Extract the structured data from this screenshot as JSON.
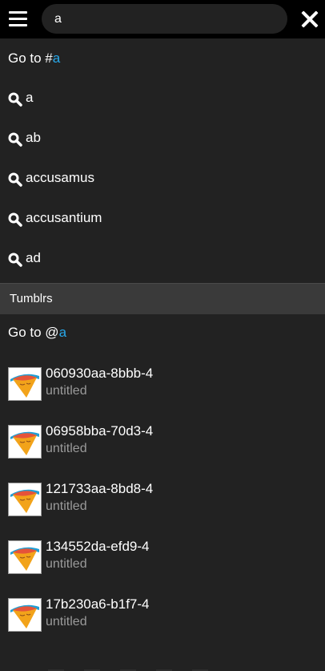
{
  "search": {
    "value": "a",
    "menu_icon": "hamburger-menu-icon",
    "close_icon": "close-x-icon"
  },
  "tag_goto": {
    "prefix": "Go to #",
    "term": "a"
  },
  "suggestions": [
    {
      "icon": "search-icon",
      "text": "a"
    },
    {
      "icon": "search-icon",
      "text": "ab"
    },
    {
      "icon": "search-icon",
      "text": "accusamus"
    },
    {
      "icon": "search-icon",
      "text": "accusantium"
    },
    {
      "icon": "search-icon",
      "text": "ad"
    }
  ],
  "tumblrs_section": {
    "heading": "Tumblrs"
  },
  "blog_goto": {
    "prefix": "Go to @",
    "term": "a"
  },
  "blogs": [
    {
      "name": "060930aa-8bbb-4",
      "title": "untitled",
      "avatar": "ice-cream-cone-avatar"
    },
    {
      "name": "06958bba-70d3-4",
      "title": "untitled",
      "avatar": "ice-cream-cone-avatar"
    },
    {
      "name": "121733aa-8bd8-4",
      "title": "untitled",
      "avatar": "ice-cream-cone-avatar"
    },
    {
      "name": "134552da-efd9-4",
      "title": "untitled",
      "avatar": "ice-cream-cone-avatar"
    },
    {
      "name": "17b230a6-b1f7-4",
      "title": "untitled",
      "avatar": "ice-cream-cone-avatar"
    }
  ],
  "colors": {
    "background": "#222222",
    "topbar": "#000000",
    "highlight": "#28a8ea",
    "section_header": "#3a3a3a",
    "muted_text": "#9a9a9a"
  }
}
